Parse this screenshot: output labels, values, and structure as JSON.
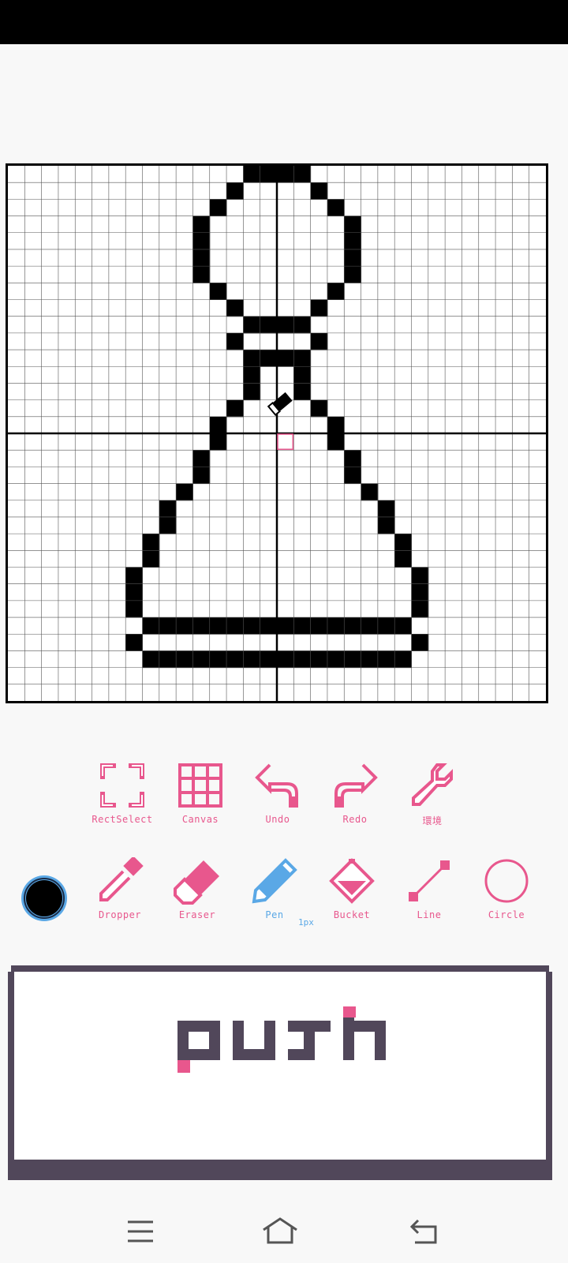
{
  "toolbar_top": {
    "rect_select_label": "RectSelect",
    "canvas_label": "Canvas",
    "undo_label": "Undo",
    "redo_label": "Redo",
    "settings_label": "環境"
  },
  "toolbar_tools": {
    "dropper_label": "Dropper",
    "eraser_label": "Eraser",
    "pen_label": "Pen",
    "pen_size": "1px",
    "bucket_label": "Bucket",
    "line_label": "Line",
    "circle_label": "Circle",
    "active_tool": "Pen"
  },
  "current_color": "#000000",
  "push_button": {
    "label": "push"
  },
  "colors": {
    "accent_pink": "#e8578d",
    "active_blue": "#5aa8e6",
    "panel_dark": "#51475a"
  }
}
